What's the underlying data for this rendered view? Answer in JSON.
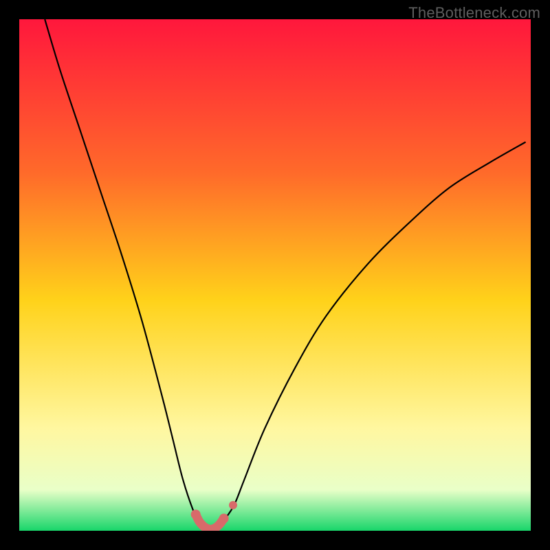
{
  "watermark": "TheBottleneck.com",
  "colors": {
    "background": "#000000",
    "gradient_top": "#ff173c",
    "gradient_mid_top": "#ff6a2a",
    "gradient_mid": "#ffd21a",
    "gradient_mid_low": "#fff7a0",
    "gradient_low": "#e9ffc8",
    "gradient_bottom": "#18d66a",
    "curve": "#000000",
    "marker_fill": "#d86a6a",
    "marker_stroke": "#c95a5a"
  },
  "chart_data": {
    "type": "line",
    "title": "",
    "xlabel": "",
    "ylabel": "",
    "xlim": [
      0,
      100
    ],
    "ylim": [
      0,
      100
    ],
    "series": [
      {
        "name": "bottleneck-curve",
        "x": [
          5,
          8,
          12,
          16,
          20,
          24,
          28,
          30,
          32,
          34,
          35.5,
          37,
          38,
          39,
          40,
          42,
          44,
          48,
          54,
          60,
          68,
          76,
          84,
          92,
          99
        ],
        "y": [
          100,
          90,
          78,
          66,
          54,
          41,
          26,
          18,
          10,
          4,
          1,
          0.3,
          0.3,
          0.8,
          2,
          5,
          10,
          20,
          32,
          42,
          52,
          60,
          67,
          72,
          76
        ]
      }
    ],
    "markers": {
      "name": "highlighted-range",
      "x_start": 34.5,
      "x_end": 40.0,
      "points": [
        {
          "x": 34.5,
          "y": 3.2
        },
        {
          "x": 35.2,
          "y": 1.8
        },
        {
          "x": 36.0,
          "y": 0.9
        },
        {
          "x": 36.8,
          "y": 0.4
        },
        {
          "x": 37.6,
          "y": 0.3
        },
        {
          "x": 38.4,
          "y": 0.6
        },
        {
          "x": 39.2,
          "y": 1.3
        },
        {
          "x": 40.0,
          "y": 2.4
        }
      ],
      "extra_point": {
        "x": 41.8,
        "y": 5.0
      }
    }
  }
}
